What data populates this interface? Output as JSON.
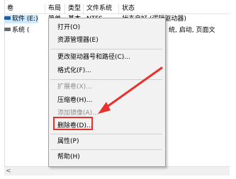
{
  "table": {
    "columns": [
      "卷",
      "布局",
      "类型",
      "文件系统",
      "状态"
    ],
    "rows": [
      {
        "volume": "软件 (E:)",
        "layout": "简单",
        "type": "基本",
        "fs": "NTFS",
        "status": "状态良好 (逻辑驱动器)"
      },
      {
        "volume": "系统 (",
        "status": "统, 启动, 页面文"
      }
    ]
  },
  "context_menu": {
    "items": [
      {
        "label": "打开(O)",
        "enabled": true
      },
      {
        "label": "资源管理器(E)",
        "enabled": true
      },
      {
        "label": "更改驱动器号和路径(C)...",
        "enabled": true
      },
      {
        "label": "格式化(F)...",
        "enabled": true
      },
      {
        "label": "扩展卷(X)...",
        "enabled": false
      },
      {
        "label": "压缩卷(H)...",
        "enabled": true
      },
      {
        "label": "添加镜像(A)...",
        "enabled": false
      },
      {
        "label": "删除卷(D)...",
        "enabled": true
      },
      {
        "label": "属性(P)",
        "enabled": true
      },
      {
        "label": "帮助(H)",
        "enabled": true
      }
    ]
  },
  "scrollbar": {
    "left_arrow": "<"
  },
  "colors": {
    "annotation": "#e8312a",
    "selection": "#cce8ff",
    "drive_icon": "#1d5ea8"
  }
}
